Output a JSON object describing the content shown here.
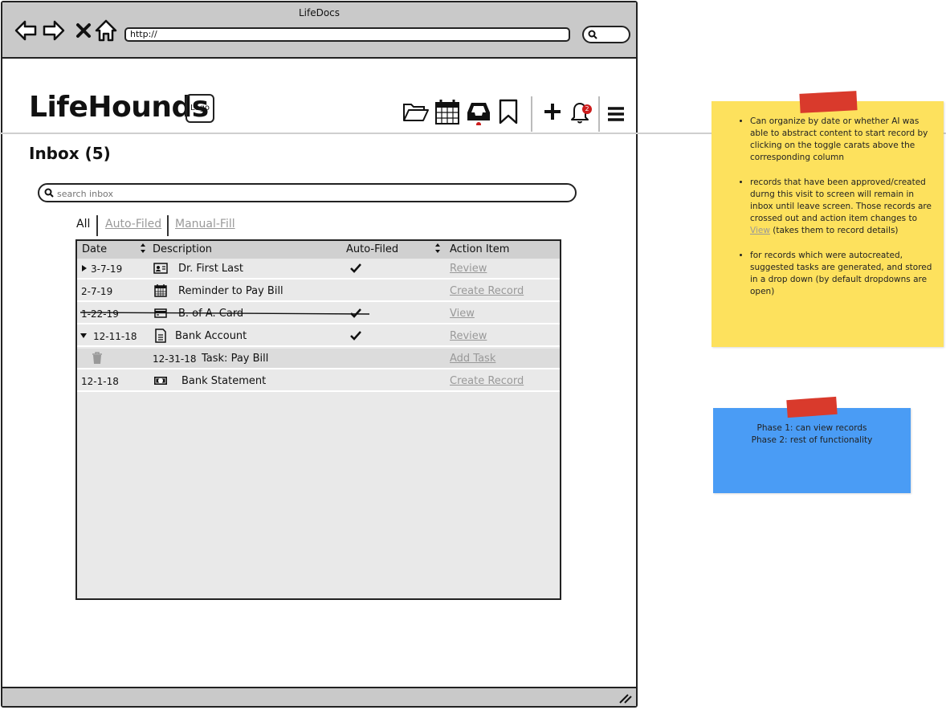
{
  "browser": {
    "title": "LifeDocs",
    "url": "http://"
  },
  "app": {
    "brand": "LifeHounds",
    "logo_label": "Logo",
    "notification_count": "2",
    "header_icons": [
      "folder-open-icon",
      "calendar-icon",
      "inbox-icon",
      "bookmark-icon",
      "plus-icon",
      "bell-icon",
      "menu-icon"
    ]
  },
  "page": {
    "title": "Inbox (5)",
    "search_placeholder": "search inbox",
    "filters": {
      "all": "All",
      "auto_filed": "Auto-Filed",
      "manual_fill": "Manual-Fill"
    }
  },
  "table": {
    "headers": {
      "date": "Date",
      "description": "Description",
      "auto_filed": "Auto-Filed",
      "action_item": "Action Item"
    },
    "rows": [
      {
        "date": "3-7-19",
        "icon": "id-card-icon",
        "description": "Dr. First Last",
        "auto_filed": true,
        "action": "Review",
        "caret": "right",
        "crossed": false
      },
      {
        "date": "2-7-19",
        "icon": "calendar-icon",
        "description": "Reminder to Pay Bill",
        "auto_filed": false,
        "action": "Create Record",
        "caret": "",
        "crossed": false
      },
      {
        "date": "1-22-19",
        "icon": "credit-card-icon",
        "description": "B. of A. Card",
        "auto_filed": true,
        "action": "View",
        "caret": "",
        "crossed": true
      },
      {
        "date": "12-11-18",
        "icon": "document-icon",
        "description": "Bank Account",
        "auto_filed": true,
        "action": "Review",
        "caret": "down",
        "crossed": false
      },
      {
        "date": "12-31-18",
        "icon": "trash-icon",
        "description": "Task: Pay Bill",
        "auto_filed": false,
        "action": "Add Task",
        "caret": "",
        "crossed": false,
        "subtask": true
      },
      {
        "date": "12-1-18",
        "icon": "money-icon",
        "description": "Bank Statement",
        "auto_filed": false,
        "action": "Create Record",
        "caret": "",
        "crossed": false
      }
    ]
  },
  "notes": {
    "yellow": {
      "color": "#fde15d",
      "bullet1": "Can organize by date or whether AI was able to abstract content to start record by clicking on the toggle carats above the corresponding column",
      "bullet2_pre": "records that have been approved/created durng this visit to screen will remain in inbox until leave screen. Those records are crossed out and action item changes to",
      "bullet2_link": "View",
      "bullet2_post": "(takes them to record details)",
      "bullet3": "for records which were autocreated, suggested tasks are generated, and stored in a drop down (by default dropdowns are open)"
    },
    "blue": {
      "color": "#4a9cf5",
      "line1": "Phase 1: can view records",
      "line2": "Phase 2: rest of functionality"
    }
  }
}
